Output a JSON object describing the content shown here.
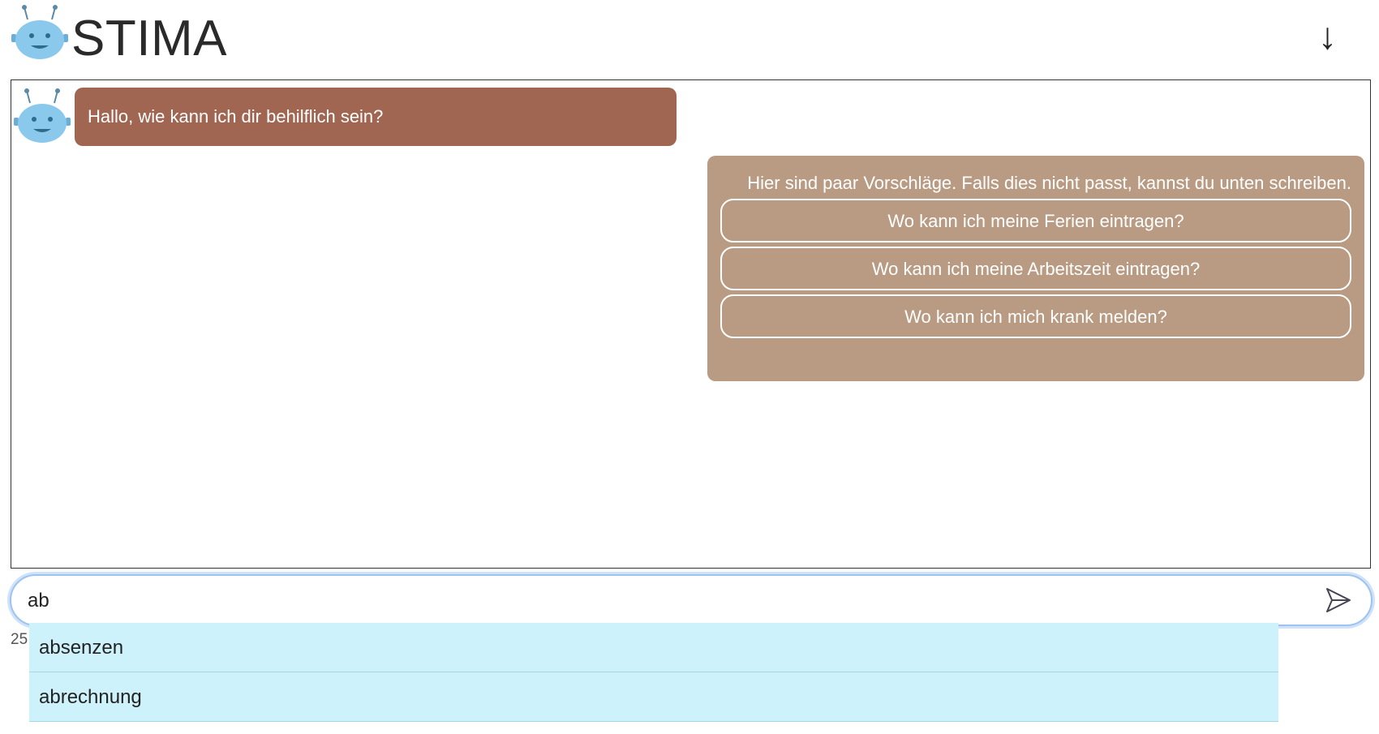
{
  "header": {
    "logo_icon": "robot-icon",
    "title": "STIMA",
    "scroll_icon": "arrow-down",
    "scroll_glyph": "↓"
  },
  "chat": {
    "bot_avatar_icon": "robot-icon",
    "bot_message": "Hallo, wie kann ich dir behilflich sein?",
    "suggestions": {
      "intro": "Hier sind paar Vorschläge. Falls dies nicht passt, kannst du unten schreiben.",
      "options": [
        "Wo kann ich meine Ferien eintragen?",
        "Wo kann ich meine Arbeitszeit eintragen?",
        "Wo kann ich mich krank melden?"
      ]
    }
  },
  "input": {
    "value": "ab",
    "send_icon": "send-icon",
    "char_count": "25"
  },
  "autocomplete": {
    "items": [
      "absenzen",
      "abrechnung"
    ]
  },
  "colors": {
    "bot_bubble": "#a06652",
    "suggest_bubble": "#b89b82",
    "autocomplete_bg": "#cdf2fb",
    "robot_face": "#8ac8ec"
  }
}
